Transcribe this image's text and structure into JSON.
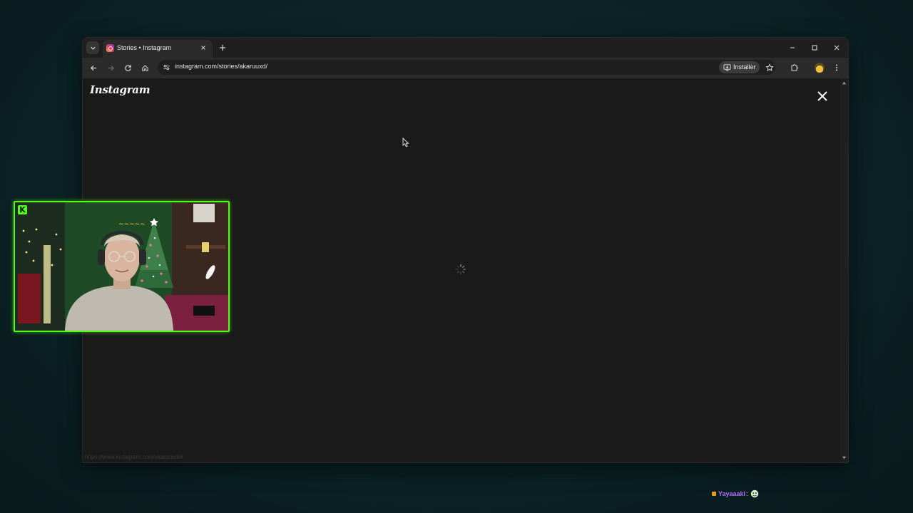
{
  "browser": {
    "tab": {
      "title": "Stories • Instagram"
    },
    "address_bar": {
      "url": "instagram.com/stories/akaruuxd/"
    },
    "install_button": {
      "label": "Installer"
    }
  },
  "page": {
    "logo_text": "Instagram",
    "status_url": "https://www.instagram.com/akaruuxd/#"
  },
  "stream": {
    "kick_badge": "K",
    "chat": {
      "username": "Yayaaakl",
      "separator": ":"
    }
  },
  "colors": {
    "kick_green": "#53fc18",
    "chat_username": "#b06bff",
    "page_bg": "#1a1a1a"
  }
}
